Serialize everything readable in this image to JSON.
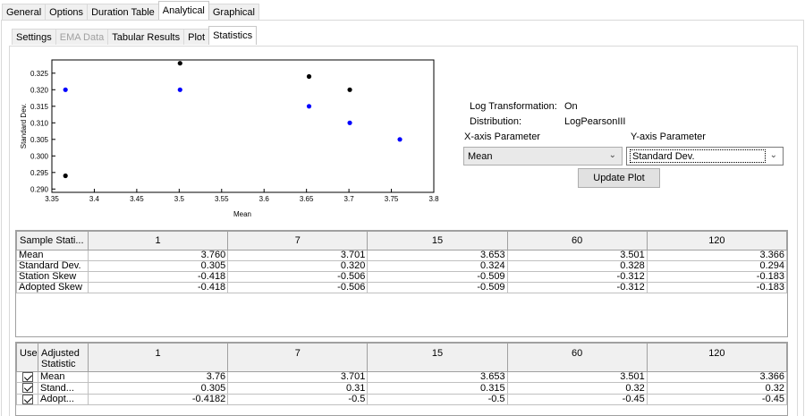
{
  "outer_tabs": [
    {
      "label": "General"
    },
    {
      "label": "Options"
    },
    {
      "label": "Duration Table"
    },
    {
      "label": "Analytical"
    },
    {
      "label": "Graphical"
    }
  ],
  "outer_active": "Analytical",
  "inner_tabs": [
    {
      "label": "Settings"
    },
    {
      "label": "EMA Data"
    },
    {
      "label": "Tabular Results"
    },
    {
      "label": "Plot"
    },
    {
      "label": "Statistics"
    }
  ],
  "inner_active": "Statistics",
  "inner_disabled": "EMA Data",
  "chart_data": {
    "type": "scatter",
    "xlabel": "Mean",
    "ylabel": "Standard Dev.",
    "xlim": [
      3.35,
      3.8
    ],
    "ylim": [
      0.289,
      0.329
    ],
    "xticks": [
      "3.35",
      "3.4",
      "3.45",
      "3.5",
      "3.55",
      "3.6",
      "3.65",
      "3.7",
      "3.75",
      "3.8"
    ],
    "xtick_values": [
      3.35,
      3.4,
      3.45,
      3.5,
      3.55,
      3.6,
      3.65,
      3.7,
      3.75,
      3.8
    ],
    "yticks": [
      "0.290",
      "0.295",
      "0.300",
      "0.305",
      "0.310",
      "0.315",
      "0.320",
      "0.325"
    ],
    "ytick_values": [
      0.29,
      0.295,
      0.3,
      0.305,
      0.31,
      0.315,
      0.32,
      0.325
    ],
    "series": [
      {
        "color": "#000000",
        "points": [
          [
            3.366,
            0.294
          ],
          [
            3.501,
            0.328
          ],
          [
            3.653,
            0.324
          ],
          [
            3.701,
            0.32
          ]
        ]
      },
      {
        "color": "#0000ff",
        "points": [
          [
            3.366,
            0.32
          ],
          [
            3.501,
            0.32
          ],
          [
            3.653,
            0.315
          ],
          [
            3.701,
            0.31
          ],
          [
            3.76,
            0.305
          ]
        ]
      }
    ]
  },
  "info": {
    "log_transformation_label": "Log Transformation:",
    "log_transformation_value": "On",
    "distribution_label": "Distribution:",
    "distribution_value": "LogPearsonIII",
    "x_param_label": "X-axis Parameter",
    "y_param_label": "Y-axis Parameter",
    "x_param_value": "Mean",
    "y_param_value": "Standard Dev.",
    "update_button": "Update Plot"
  },
  "sample_table": {
    "header": "Sample Stati...",
    "columns": [
      "1",
      "7",
      "15",
      "60",
      "120"
    ],
    "rows": [
      {
        "label": "Mean",
        "values": [
          "3.760",
          "3.701",
          "3.653",
          "3.501",
          "3.366"
        ]
      },
      {
        "label": "Standard Dev.",
        "values": [
          "0.305",
          "0.320",
          "0.324",
          "0.328",
          "0.294"
        ]
      },
      {
        "label": "Station Skew",
        "values": [
          "-0.418",
          "-0.506",
          "-0.509",
          "-0.312",
          "-0.183"
        ]
      },
      {
        "label": "Adopted Skew",
        "values": [
          "-0.418",
          "-0.506",
          "-0.509",
          "-0.312",
          "-0.183"
        ]
      }
    ]
  },
  "adjusted_table": {
    "use_header": "Use",
    "header_line1": "Adjusted",
    "header_line2": "Statistic",
    "columns": [
      "1",
      "7",
      "15",
      "60",
      "120"
    ],
    "rows": [
      {
        "label": "Mean",
        "checked": true,
        "values": [
          "3.76",
          "3.701",
          "3.653",
          "3.501",
          "3.366"
        ]
      },
      {
        "label": "Stand...",
        "checked": true,
        "values": [
          "0.305",
          "0.31",
          "0.315",
          "0.32",
          "0.32"
        ]
      },
      {
        "label": "Adopt...",
        "checked": true,
        "values": [
          "-0.4182",
          "-0.5",
          "-0.5",
          "-0.45",
          "-0.45"
        ]
      }
    ]
  }
}
